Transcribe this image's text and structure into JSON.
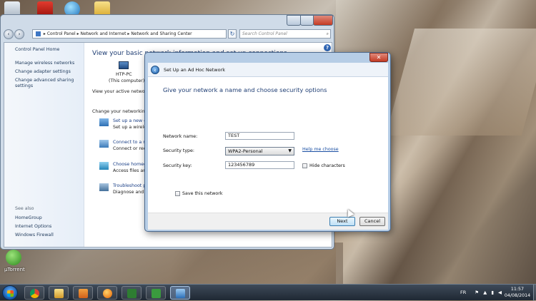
{
  "control_panel": {
    "address": {
      "root": "Control Panel",
      "part2": "Network and Internet",
      "part3": "Network and Sharing Center"
    },
    "search_placeholder": "Search Control Panel",
    "sidebar": {
      "home": "Control Panel Home",
      "links": [
        "Manage wireless networks",
        "Change adapter settings",
        "Change advanced sharing",
        "settings"
      ],
      "see_also_label": "See also",
      "see_also": [
        "HomeGroup",
        "Internet Options",
        "Windows Firewall"
      ]
    },
    "main": {
      "title": "View your basic network information and set up connections",
      "computer_name": "HTP-PC",
      "computer_sub": "(This computer)",
      "active_networks": "View your active networks",
      "change_settings": "Change your networking s",
      "tasks": [
        {
          "link": "Set up a new co",
          "desc": "Set up a wireless"
        },
        {
          "link": "Connect to a net",
          "desc": "Connect or recon"
        },
        {
          "link": "Choose homeg",
          "desc": "Access files and"
        },
        {
          "link": "Troubleshoot pr",
          "desc": "Diagnose and re"
        }
      ]
    }
  },
  "dialog": {
    "title": "Set Up an Ad Hoc Network",
    "heading": "Give your network a name and choose security options",
    "network_name_label": "Network name:",
    "network_name_value": "TEST",
    "security_type_label": "Security type:",
    "security_type_value": "WPA2-Personal",
    "help_link": "Help me choose",
    "security_key_label": "Security key:",
    "security_key_value": "123456789",
    "hide_characters": "Hide characters",
    "save_network": "Save this network",
    "next": "Next",
    "cancel": "Cancel"
  },
  "desktop": {
    "utorrent_label": "µTorrent"
  },
  "taskbar": {
    "language": "FR",
    "time": "11:57",
    "date": "04/08/2014",
    "apps": [
      "chrome-icon",
      "explorer-icon",
      "media-player-icon",
      "firefox-icon",
      "camtasia-icon",
      "camtasia-recorder-icon",
      "control-panel-icon"
    ]
  }
}
